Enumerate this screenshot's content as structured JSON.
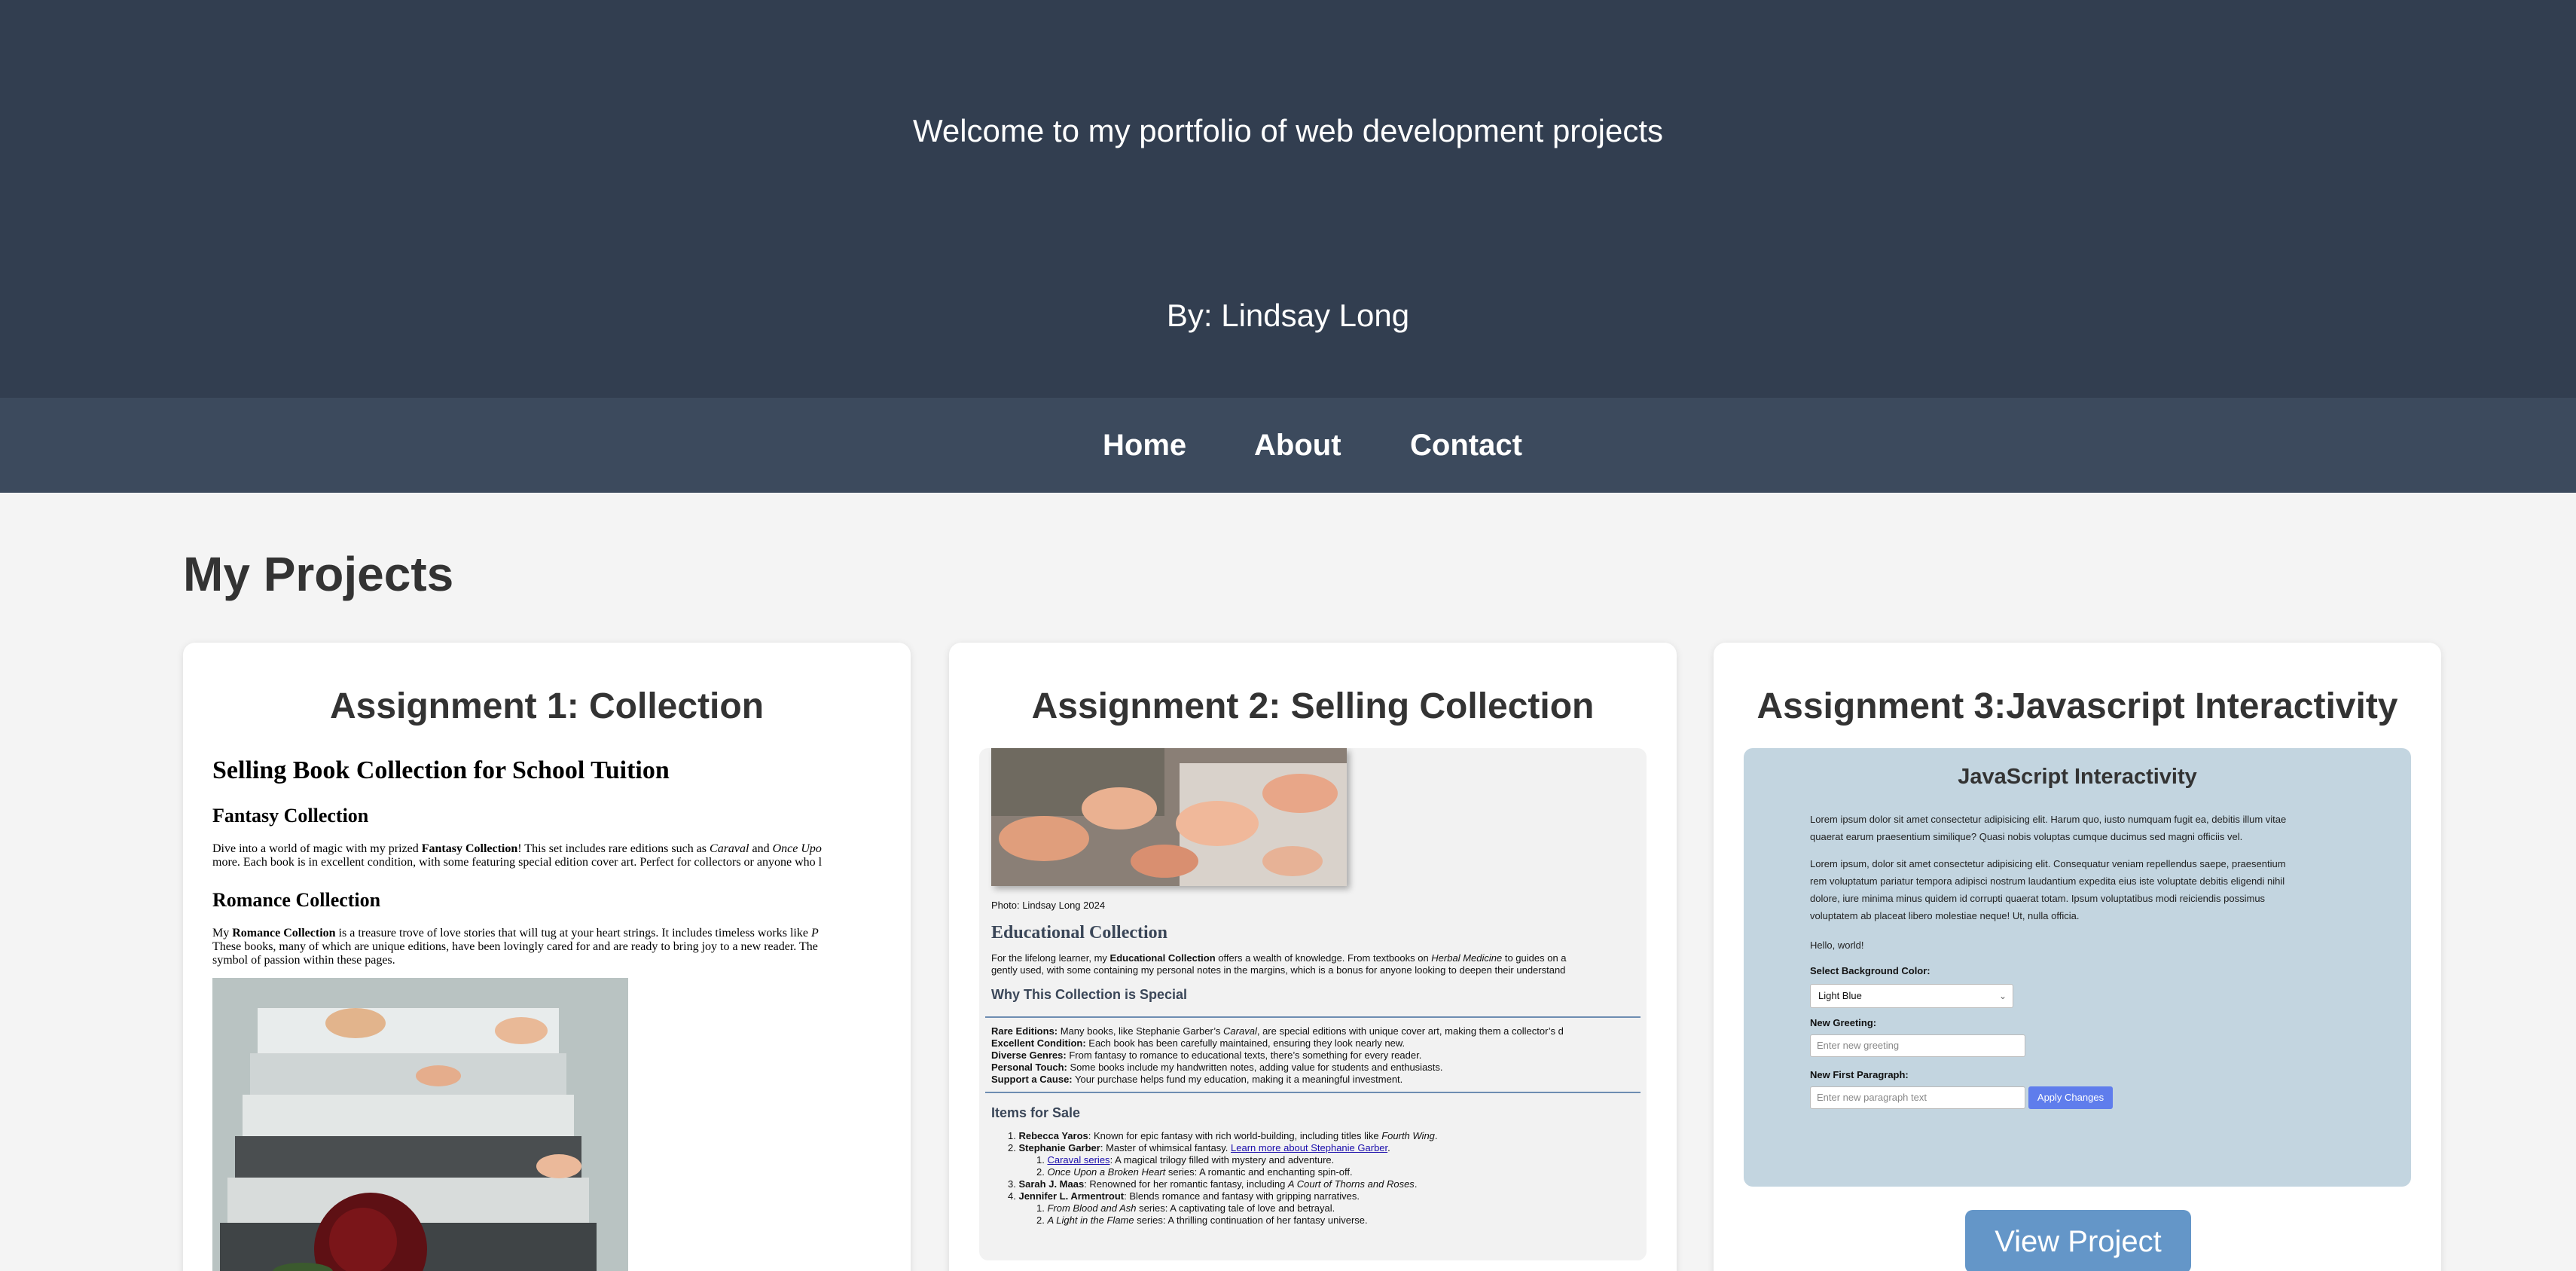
{
  "hero": {
    "welcome": "Welcome to my portfolio of web development projects",
    "byline": "By: Lindsay Long"
  },
  "nav": {
    "items": [
      "Home",
      "About",
      "Contact"
    ]
  },
  "projects_title": "My Projects",
  "cards": [
    {
      "title": "Assignment 1: Collection",
      "preview": {
        "heading": "Selling Book Collection for School Tuition",
        "sections": [
          {
            "heading": "Fantasy Collection",
            "text_a": "Dive into a world of magic with my prized ",
            "text_b": "Fantasy Collection",
            "text_c": "! This set includes rare editions such as ",
            "text_d": "Caraval",
            "text_e": " and ",
            "text_f": "Once Upo",
            "line2": "more. Each book is in excellent condition, with some featuring special edition cover art. Perfect for collectors or anyone who l"
          },
          {
            "heading": "Romance Collection",
            "text_a": "My ",
            "text_b": "Romance Collection",
            "text_c": " is a treasure trove of love stories that will tug at your heart strings. It includes timeless works like ",
            "text_d": "P",
            "line2": "These books, many of which are unique editions, have been lovingly cared for and are ready to bring joy to a new reader. The",
            "line3": "symbol of passion within these pages."
          }
        ]
      }
    },
    {
      "title": "Assignment 2: Selling Collection",
      "preview": {
        "caption": "Photo: Lindsay Long 2024",
        "heading": "Educational Collection",
        "intro_a": "For the lifelong learner, my ",
        "intro_b": "Educational Collection",
        "intro_c": " offers a wealth of knowledge. From textbooks on ",
        "intro_d": "Herbal Medicine",
        "intro_e": " to guides on a",
        "intro_line2": "gently used, with some containing my personal notes in the margins, which is a bonus for anyone looking to deepen their understand",
        "special_heading": "Why This Collection is Special",
        "special": [
          {
            "label": "Rare Editions:",
            "text": " Many books, like Stephanie Garber’s ",
            "em": "Caraval",
            "tail": ", are special editions with unique cover art, making them a collector’s d"
          },
          {
            "label": "Excellent Condition:",
            "text": " Each book has been carefully maintained, ensuring they look nearly new."
          },
          {
            "label": "Diverse Genres:",
            "text": " From fantasy to romance to educational texts, there’s something for every reader."
          },
          {
            "label": "Personal Touch:",
            "text": " Some books include my handwritten notes, adding value for students and enthusiasts."
          },
          {
            "label": "Support a Cause:",
            "text": " Your purchase helps fund my education, making it a meaningful investment."
          }
        ],
        "items_heading": "Items for Sale",
        "items": [
          {
            "num": "1.",
            "label": "Rebecca Yaros",
            "text": ": Known for epic fantasy with rich world-building, including titles like ",
            "em": "Fourth Wing",
            "tail": "."
          },
          {
            "num": "2.",
            "label": "Stephanie Garber",
            "text": ": Master of whimsical fantasy. ",
            "link": "Learn more about Stephanie Garber",
            "tail": "."
          },
          {
            "num": "3.",
            "label": "Sarah J. Maas",
            "text": ": Renowned for her romantic fantasy, including ",
            "em": "A Court of Thorns and Roses",
            "tail": "."
          },
          {
            "num": "4.",
            "label": "Jennifer L. Armentrout",
            "text": ": Blends romance and fantasy with gripping narratives."
          }
        ],
        "garber_sub": [
          {
            "num": "1.",
            "link": "Caraval series",
            "text": ": A magical trilogy filled with mystery and adventure."
          },
          {
            "num": "2.",
            "em": "Once Upon a Broken Heart",
            "text": " series: A romantic and enchanting spin-off."
          }
        ],
        "armentrout_sub": [
          {
            "num": "1.",
            "em": "From Blood and Ash",
            "text": " series: A captivating tale of love and betrayal."
          },
          {
            "num": "2.",
            "em": "A Light in the Flame",
            "text": " series: A thrilling continuation of her fantasy universe."
          }
        ]
      }
    },
    {
      "title": "Assignment 3:Javascript Interactivity",
      "preview": {
        "heading": "JavaScript Interactivity",
        "para1_line1": "Lorem ipsum dolor sit amet consectetur adipisicing elit. Harum quo, iusto numquam fugit ea, debitis illum vitae",
        "para1_line2": "quaerat earum praesentium similique? Quasi nobis voluptas cumque ducimus sed magni officiis vel.",
        "para2_line1": "Lorem ipsum, dolor sit amet consectetur adipisicing elit. Consequatur veniam repellendus saepe, praesentium",
        "para2_line2": "rem voluptatum pariatur tempora adipisci nostrum laudantium expedita eius iste voluptate debitis eligendi nihil",
        "para2_line3": "dolore, iure minima minus quidem id corrupti quaerat totam. Ipsum voluptatibus modi reiciendis possimus",
        "para2_line4": "voluptatem ab placeat libero molestiae neque! Ut, nulla officia.",
        "greeting": "Hello, world!",
        "bg_label": "Select Background Color:",
        "bg_value": "Light Blue",
        "greeting_label": "New Greeting:",
        "greeting_placeholder": "Enter new greeting",
        "para_label": "New First Paragraph:",
        "para_placeholder": "Enter new paragraph text",
        "apply_label": "Apply Changes"
      },
      "button": "View Project"
    }
  ]
}
